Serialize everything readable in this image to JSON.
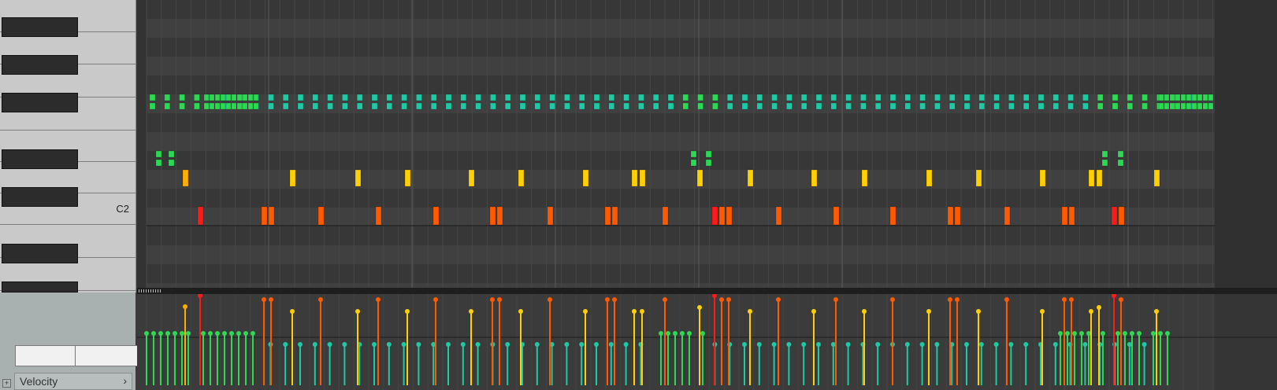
{
  "keyboard": {
    "note_label": "C2",
    "black_keys": 7
  },
  "velocity_lane": {
    "selector_label": "Velocity",
    "chevron_icon": "chevron-right-icon",
    "expand_icon": "expand-plus-icon"
  },
  "colors": {
    "hihat": "#1ec9a4",
    "hihat_alt": "#2ed855",
    "perc": "#ffd000",
    "kick": "#ff5a00",
    "kick_accent": "#ff1a1a"
  }
}
